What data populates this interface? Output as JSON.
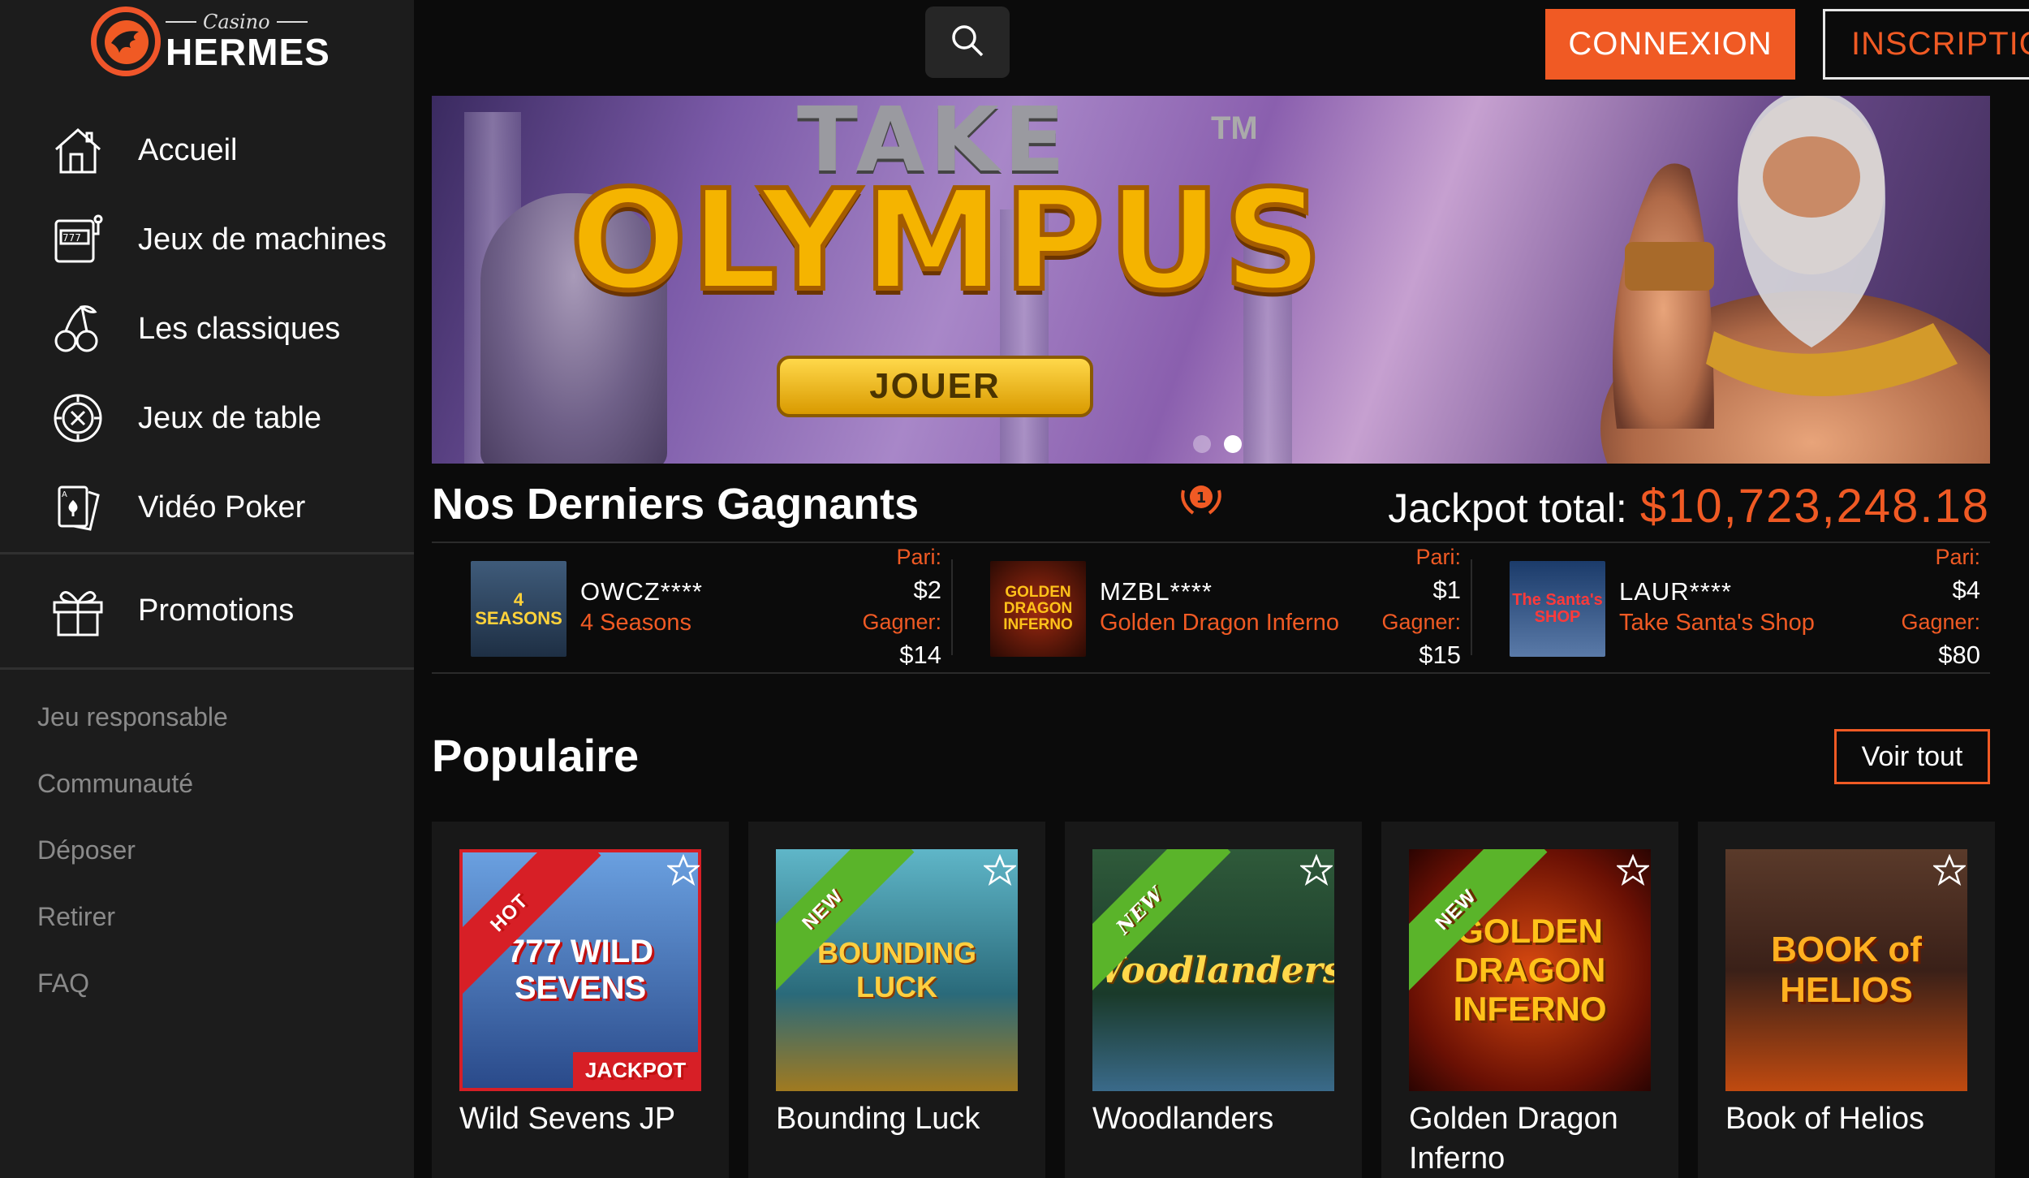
{
  "brand": {
    "casino": "Casino",
    "name": "HERMES"
  },
  "nav": {
    "items": [
      {
        "label": "Accueil",
        "icon": "home-icon"
      },
      {
        "label": "Jeux de machines",
        "icon": "slot-machine-icon"
      },
      {
        "label": "Les classiques",
        "icon": "cherries-icon"
      },
      {
        "label": "Jeux de table",
        "icon": "poker-chip-icon"
      },
      {
        "label": "Vidéo Poker",
        "icon": "playing-cards-icon"
      }
    ],
    "promotions": {
      "label": "Promotions",
      "icon": "gift-icon"
    },
    "secondary": [
      "Jeu responsable",
      "Communauté",
      "Déposer",
      "Retirer",
      "FAQ"
    ]
  },
  "header": {
    "search_icon": "search-icon",
    "login": "CONNEXION",
    "register": "INSCRIPTION"
  },
  "banner": {
    "title_top": "TAKE",
    "tm": "TM",
    "title_main": "OLYMPUS",
    "cta": "JOUER",
    "slides": 2,
    "active_slide": 2
  },
  "winners": {
    "title": "Nos Derniers Gagnants",
    "medal_number": "1",
    "jackpot_label": "Jackpot total:",
    "jackpot_value": "$10,723,248.18",
    "bet_label": "Pari:",
    "win_label": "Gagner:",
    "items": [
      {
        "user": "OWCZ****",
        "game": "4 Seasons",
        "bet": "$2",
        "win": "$14",
        "thumb_text": "4 SEASONS"
      },
      {
        "user": "MZBL****",
        "game": "Golden Dragon Inferno",
        "bet": "$1",
        "win": "$15",
        "thumb_text": "GOLDEN DRAGON INFERNO"
      },
      {
        "user": "LAUR****",
        "game": "Take Santa's Shop",
        "bet": "$4",
        "win": "$80",
        "thumb_text": "The Santa's SHOP"
      }
    ]
  },
  "popular": {
    "title": "Populaire",
    "see_all": "Voir tout",
    "games": [
      {
        "name": "Wild Sevens JP",
        "badge": "HOT",
        "jackpot": "JACKPOT",
        "art_text": "777 WILD SEVENS"
      },
      {
        "name": "Bounding Luck",
        "badge": "NEW",
        "art_text": "BOUNDING LUCK"
      },
      {
        "name": "Woodlanders",
        "badge": "NEW",
        "art_text": "Woodlanders"
      },
      {
        "name": "Golden Dragon Inferno",
        "badge": "NEW",
        "art_text": "GOLDEN DRAGON INFERNO"
      },
      {
        "name": "Book of Helios",
        "badge": "",
        "art_text": "BOOK of HELIOS"
      }
    ]
  },
  "colors": {
    "accent": "#f05a24",
    "sidebar": "#1c1c1c",
    "background": "#0b0b0b",
    "hot": "#d71f26",
    "new": "#5ab42a"
  }
}
